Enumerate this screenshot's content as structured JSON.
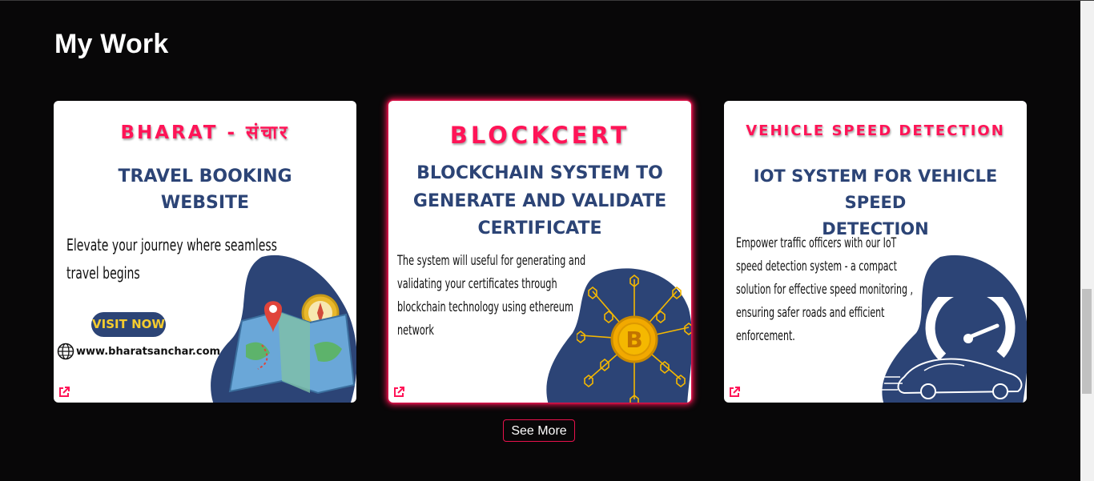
{
  "section": {
    "title": "My Work"
  },
  "projects": [
    {
      "brand": "BHARAT - संचार",
      "heading_line1": "TRAVEL BOOKING",
      "heading_line2": "WEBSITE",
      "description_line1": "Elevate your journey where seamless",
      "description_line2": "travel begins",
      "cta_label": "VISIT NOW",
      "website": "www.bharatsanchar.com",
      "icon": "map-icon"
    },
    {
      "brand": "BLOCKCERT",
      "heading_line1": "BLOCKCHAIN SYSTEM TO",
      "heading_line2": "GENERATE AND VALIDATE",
      "heading_line3": "CERTIFICATE",
      "description_line1": "The system will useful for generating and",
      "description_line2": "validating your certificates through",
      "description_line3": "blockchain technology using ethereum",
      "description_line4": "network",
      "icon": "bitcoin-network-icon"
    },
    {
      "brand": "VEHICLE SPEED DETECTION",
      "heading_line1": "IOT SYSTEM FOR VEHICLE SPEED",
      "heading_line2": "DETECTION",
      "description_line1": "Empower traffic officers with our IoT",
      "description_line2": "speed detection system - a compact",
      "description_line3": "solution for effective speed monitoring ,",
      "description_line4": "ensuring safer roads and efficient",
      "description_line5": "enforcement.",
      "icon": "speed-car-icon"
    }
  ],
  "see_more_label": "See More",
  "colors": {
    "accent": "#ff1457",
    "navy": "#2c4476",
    "background": "#080708",
    "gold": "#f5cc2e"
  }
}
